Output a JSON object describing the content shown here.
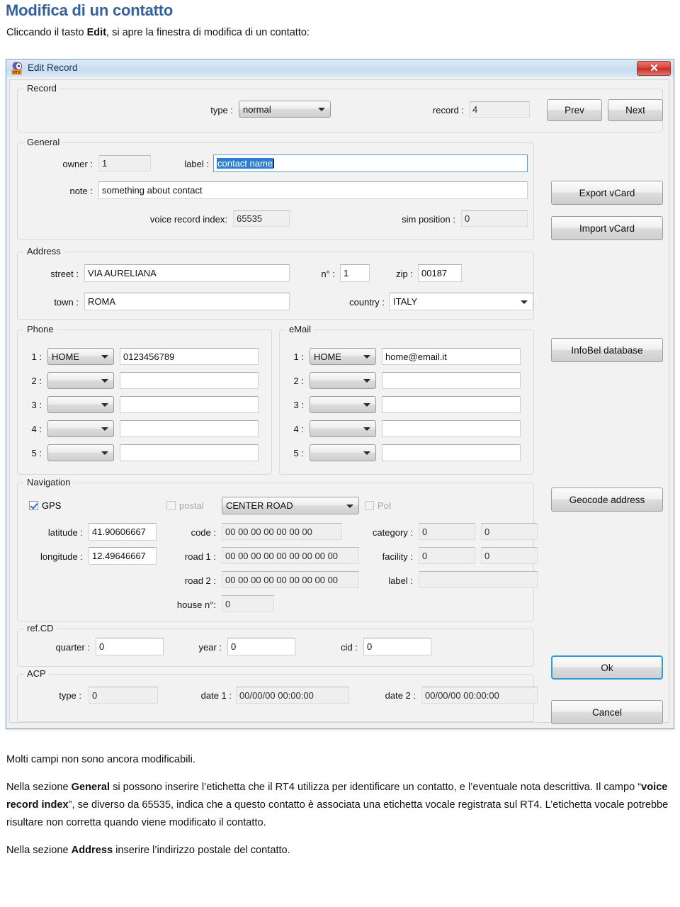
{
  "document": {
    "heading": "Modifica di un contatto",
    "intro_before": "Cliccando  il tasto ",
    "intro_bold": "Edit",
    "intro_after": ", si apre la finestra di modifica di un contatto:",
    "paragraphs": {
      "p1": "Molti campi non sono ancora modificabili.",
      "p2a": "Nella sezione ",
      "p2b": "General",
      "p2c": " si possono inserire l’etichetta che il RT4 utilizza per identificare un contatto, e l’eventuale nota descrittiva. Il campo “",
      "p2d": "voice record index",
      "p2e": "”, se diverso da 65535, indica che a questo contatto è associata una etichetta vocale registrata sul RT4. L’etichetta vocale potrebbe risultare non corretta quando viene modificato il contatto.",
      "p3a": "Nella sezione ",
      "p3b": "Address",
      "p3c": " inserire l’indirizzo postale del contatto."
    }
  },
  "window": {
    "title": "Edit Record",
    "icon": "app-icon",
    "close_label": "close-icon"
  },
  "record": {
    "group_title": "Record",
    "type_label": "type :",
    "type_value": "normal",
    "record_label": "record :",
    "record_value": "4",
    "prev_label": "Prev",
    "next_label": "Next"
  },
  "general": {
    "group_title": "General",
    "owner_label": "owner :",
    "owner_value": "1",
    "label_label": "label :",
    "label_value": "contact name",
    "note_label": "note :",
    "note_value": "something about contact",
    "voice_label": "voice record index:",
    "voice_value": "65535",
    "sim_label": "sim position :",
    "sim_value": "0"
  },
  "address": {
    "group_title": "Address",
    "street_label": "street :",
    "street_value": "VIA AURELIANA",
    "number_label": "n° :",
    "number_value": "1",
    "zip_label": "zip :",
    "zip_value": "00187",
    "town_label": "town :",
    "town_value": "ROMA",
    "country_label": "country :",
    "country_value": "ITALY"
  },
  "phone": {
    "group_title": "Phone",
    "rows": [
      {
        "index": "1 :",
        "type": "HOME",
        "number": "0123456789"
      },
      {
        "index": "2 :",
        "type": "",
        "number": ""
      },
      {
        "index": "3 :",
        "type": "",
        "number": ""
      },
      {
        "index": "4 :",
        "type": "",
        "number": ""
      },
      {
        "index": "5 :",
        "type": "",
        "number": ""
      }
    ]
  },
  "email": {
    "group_title": "eMail",
    "rows": [
      {
        "index": "1 :",
        "type": "HOME",
        "address": "home@email.it"
      },
      {
        "index": "2 :",
        "type": "",
        "address": ""
      },
      {
        "index": "3 :",
        "type": "",
        "address": ""
      },
      {
        "index": "4 :",
        "type": "",
        "address": ""
      },
      {
        "index": "5 :",
        "type": "",
        "address": ""
      }
    ]
  },
  "navigation": {
    "group_title": "Navigation",
    "gps_label": "GPS",
    "gps_checked": true,
    "postal_label": "postal",
    "postal_checked": false,
    "roadtype_value": "CENTER ROAD",
    "poi_label": "PoI",
    "poi_checked": false,
    "latitude_label": "latitude :",
    "latitude_value": "41.90606667",
    "longitude_label": "longitude :",
    "longitude_value": "12.49646667",
    "code_label": "code :",
    "code_value": "00 00 00 00 00 00 00",
    "road1_label": "road 1 :",
    "road1_value": "00 00 00 00 00 00 00 00 00",
    "road2_label": "road 2 :",
    "road2_value": "00 00 00 00 00 00 00 00 00",
    "house_label": "house n°:",
    "house_value": "0",
    "category_label": "category :",
    "category_value_1": "0",
    "category_value_2": "0",
    "facility_label": "facility :",
    "facility_value_1": "0",
    "facility_value_2": "0",
    "label_label": "label :",
    "label_value": ""
  },
  "refcd": {
    "group_title": "ref.CD",
    "quarter_label": "quarter :",
    "quarter_value": "0",
    "year_label": "year :",
    "year_value": "0",
    "cid_label": "cid :",
    "cid_value": "0"
  },
  "acp": {
    "group_title": "ACP",
    "type_label": "type :",
    "type_value": "0",
    "date1_label": "date 1 :",
    "date1_value": "00/00/00 00:00:00",
    "date2_label": "date 2 :",
    "date2_value": "00/00/00 00:00:00"
  },
  "side_buttons": {
    "export_vcard": "Export vCard",
    "import_vcard": "Import vCard",
    "infobel": "InfoBel database",
    "geocode": "Geocode address",
    "ok": "Ok",
    "cancel": "Cancel"
  },
  "colors": {
    "heading": "#36619a",
    "selection": "#2a7fd4",
    "focus_ring": "#2e9bd6",
    "close_button": "#c22f26"
  }
}
